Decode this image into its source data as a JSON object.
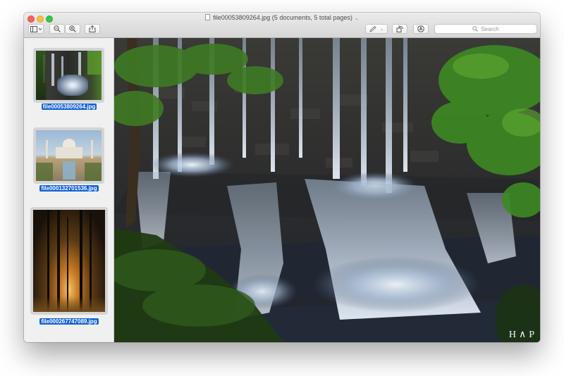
{
  "window": {
    "title": "file00053809264.jpg (5 documents, 5 total pages)"
  },
  "toolbar": {
    "search_placeholder": "Search"
  },
  "sidebar": {
    "thumbnails": [
      {
        "label": "file00053809264.jpg",
        "selected": true
      },
      {
        "label": "file000132701536.jpg",
        "selected": false
      },
      {
        "label": "file000267747089.jpg",
        "selected": false
      }
    ]
  },
  "viewer": {
    "watermark": "H∧P"
  },
  "colors": {
    "selection": "#1361d6",
    "close": "#fc605c",
    "minimize": "#fdbc40",
    "maximize": "#34c84a"
  }
}
